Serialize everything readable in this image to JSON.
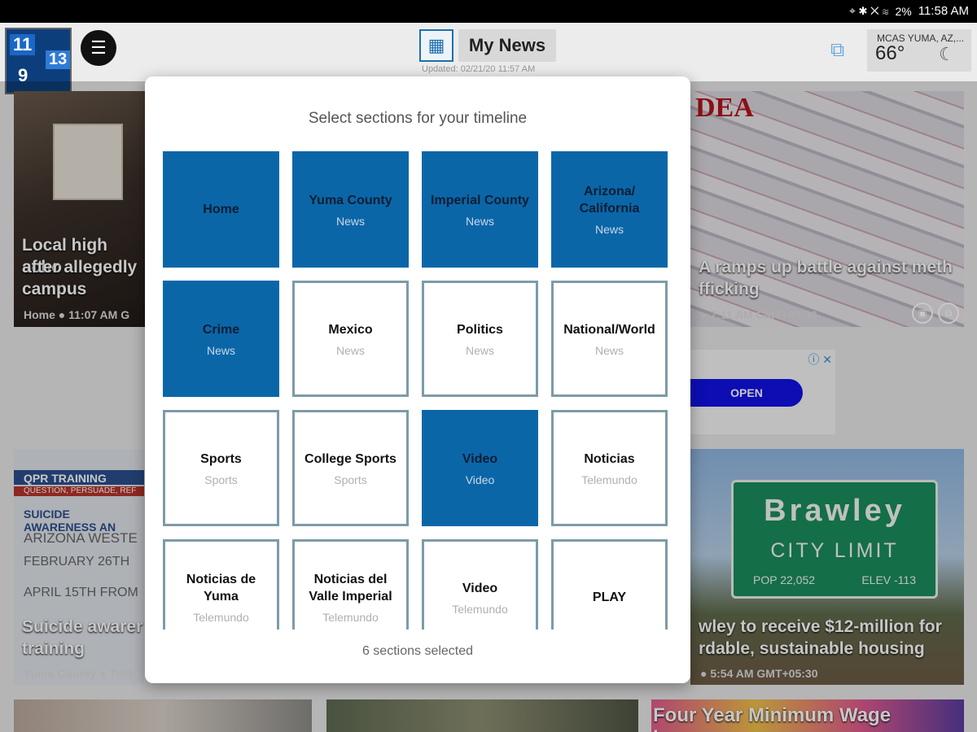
{
  "statusbar": {
    "icons": "⌖ ✱ ✕ ≋",
    "battery": "2%",
    "time": "11:58 AM"
  },
  "header": {
    "logo": {
      "n1": "11",
      "n2": "13",
      "n3": "9"
    },
    "menu_icon": "☰",
    "grid_icon": "▦",
    "title": "My News",
    "updated": "Updated: 02/21/20 11:57 AM",
    "cast_icon": "⧉",
    "weather": {
      "location": "MCAS YUMA, AZ,...",
      "temp": "66°",
      "icon": "☾"
    }
  },
  "cards": [
    {
      "title_lines": [
        "Local high scho",
        "after allegedly",
        "campus"
      ],
      "meta": "Home ● 11:07 AM G"
    },
    {
      "title_lines": [
        "A ramps up battle against meth",
        "fficking"
      ],
      "meta": "● 7:11 AM GMT+05:30",
      "banner": "DEA"
    },
    {
      "title_lines": [
        "Suicide awarer",
        "training"
      ],
      "meta": "Yuma County ● 7:09",
      "board": [
        "QPR TRAINING",
        "QUESTION, PERSUADE, REF",
        "SUICIDE AWARENESS AN",
        "ARIZONA WESTE",
        "FEBRUARY 26TH",
        "APRIL 15TH FROM"
      ]
    },
    {
      "title_lines": [
        "wley to receive $12-million for",
        "rdable, sustainable housing"
      ],
      "meta": "● 5:54 AM GMT+05:30",
      "sign": {
        "city": "Brawley",
        "limit": "CITY LIMIT",
        "pop": "POP 22,052",
        "elev": "ELEV -113"
      }
    },
    {
      "title_lines": [
        "Four Year Minimum Wage Increas"
      ]
    }
  ],
  "ad": {
    "button": "OPEN",
    "icons": "ⓘ ✕"
  },
  "modal": {
    "title": "Select sections for your timeline",
    "footer": "6 sections selected",
    "tiles": [
      {
        "name": "Home",
        "sub": "",
        "selected": true
      },
      {
        "name": "Yuma County",
        "sub": "News",
        "selected": true
      },
      {
        "name": "Imperial County",
        "sub": "News",
        "selected": true
      },
      {
        "name": "Arizona/ California",
        "sub": "News",
        "selected": true
      },
      {
        "name": "Crime",
        "sub": "News",
        "selected": true
      },
      {
        "name": "Mexico",
        "sub": "News",
        "selected": false
      },
      {
        "name": "Politics",
        "sub": "News",
        "selected": false
      },
      {
        "name": "National/World",
        "sub": "News",
        "selected": false
      },
      {
        "name": "Sports",
        "sub": "Sports",
        "selected": false
      },
      {
        "name": "College Sports",
        "sub": "Sports",
        "selected": false
      },
      {
        "name": "Video",
        "sub": "Video",
        "selected": true
      },
      {
        "name": "Noticias",
        "sub": "Telemundo",
        "selected": false
      },
      {
        "name": "Noticias de Yuma",
        "sub": "Telemundo",
        "selected": false
      },
      {
        "name": "Noticias del Valle Imperial",
        "sub": "Telemundo",
        "selected": false
      },
      {
        "name": "Video",
        "sub": "Telemundo",
        "selected": false
      },
      {
        "name": "PLAY",
        "sub": "",
        "selected": false
      }
    ]
  }
}
